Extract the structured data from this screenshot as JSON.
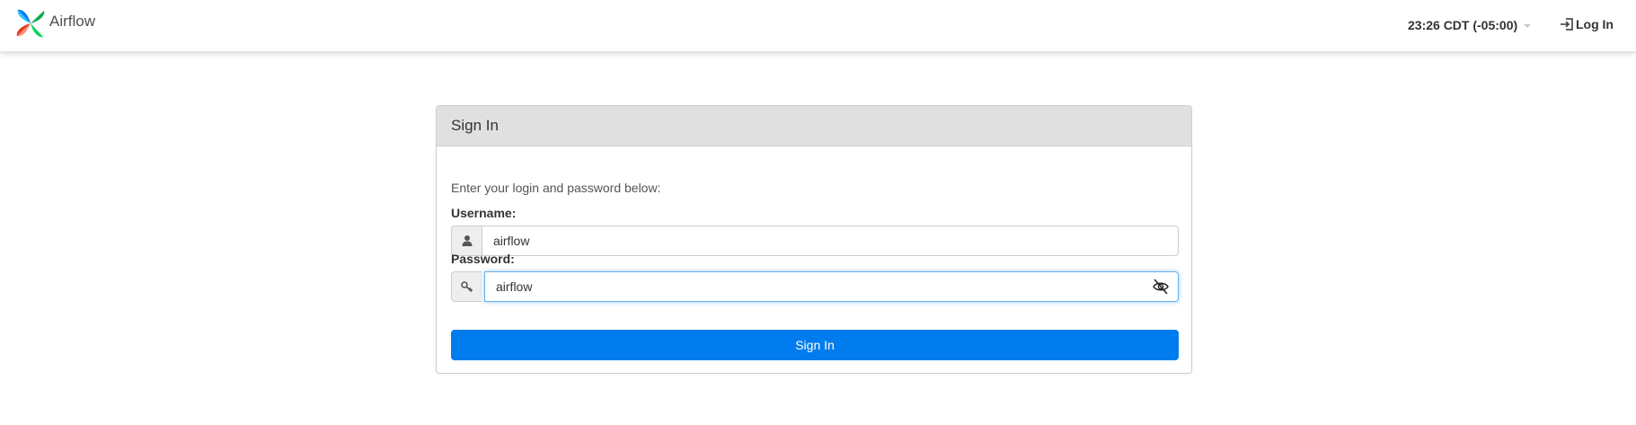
{
  "navbar": {
    "brand_name": "Airflow",
    "timezone": "23:26 CDT (-05:00)",
    "login_label": "Log In"
  },
  "login": {
    "heading": "Sign In",
    "instructions": "Enter your login and password below:",
    "username_label": "Username:",
    "username_value": "airflow",
    "password_label": "Password:",
    "password_value": "airflow",
    "submit_label": "Sign In"
  },
  "colors": {
    "primary": "#017cee",
    "panel_heading_bg": "#e0e0e0",
    "focus_border": "#66afe9"
  },
  "icons": {
    "brand": "airflow-pinwheel-logo",
    "timezone_caret": "caret-down-icon",
    "login": "sign-in-icon",
    "username": "user-icon",
    "password": "key-icon",
    "toggle_password": "eye-slash-icon"
  }
}
